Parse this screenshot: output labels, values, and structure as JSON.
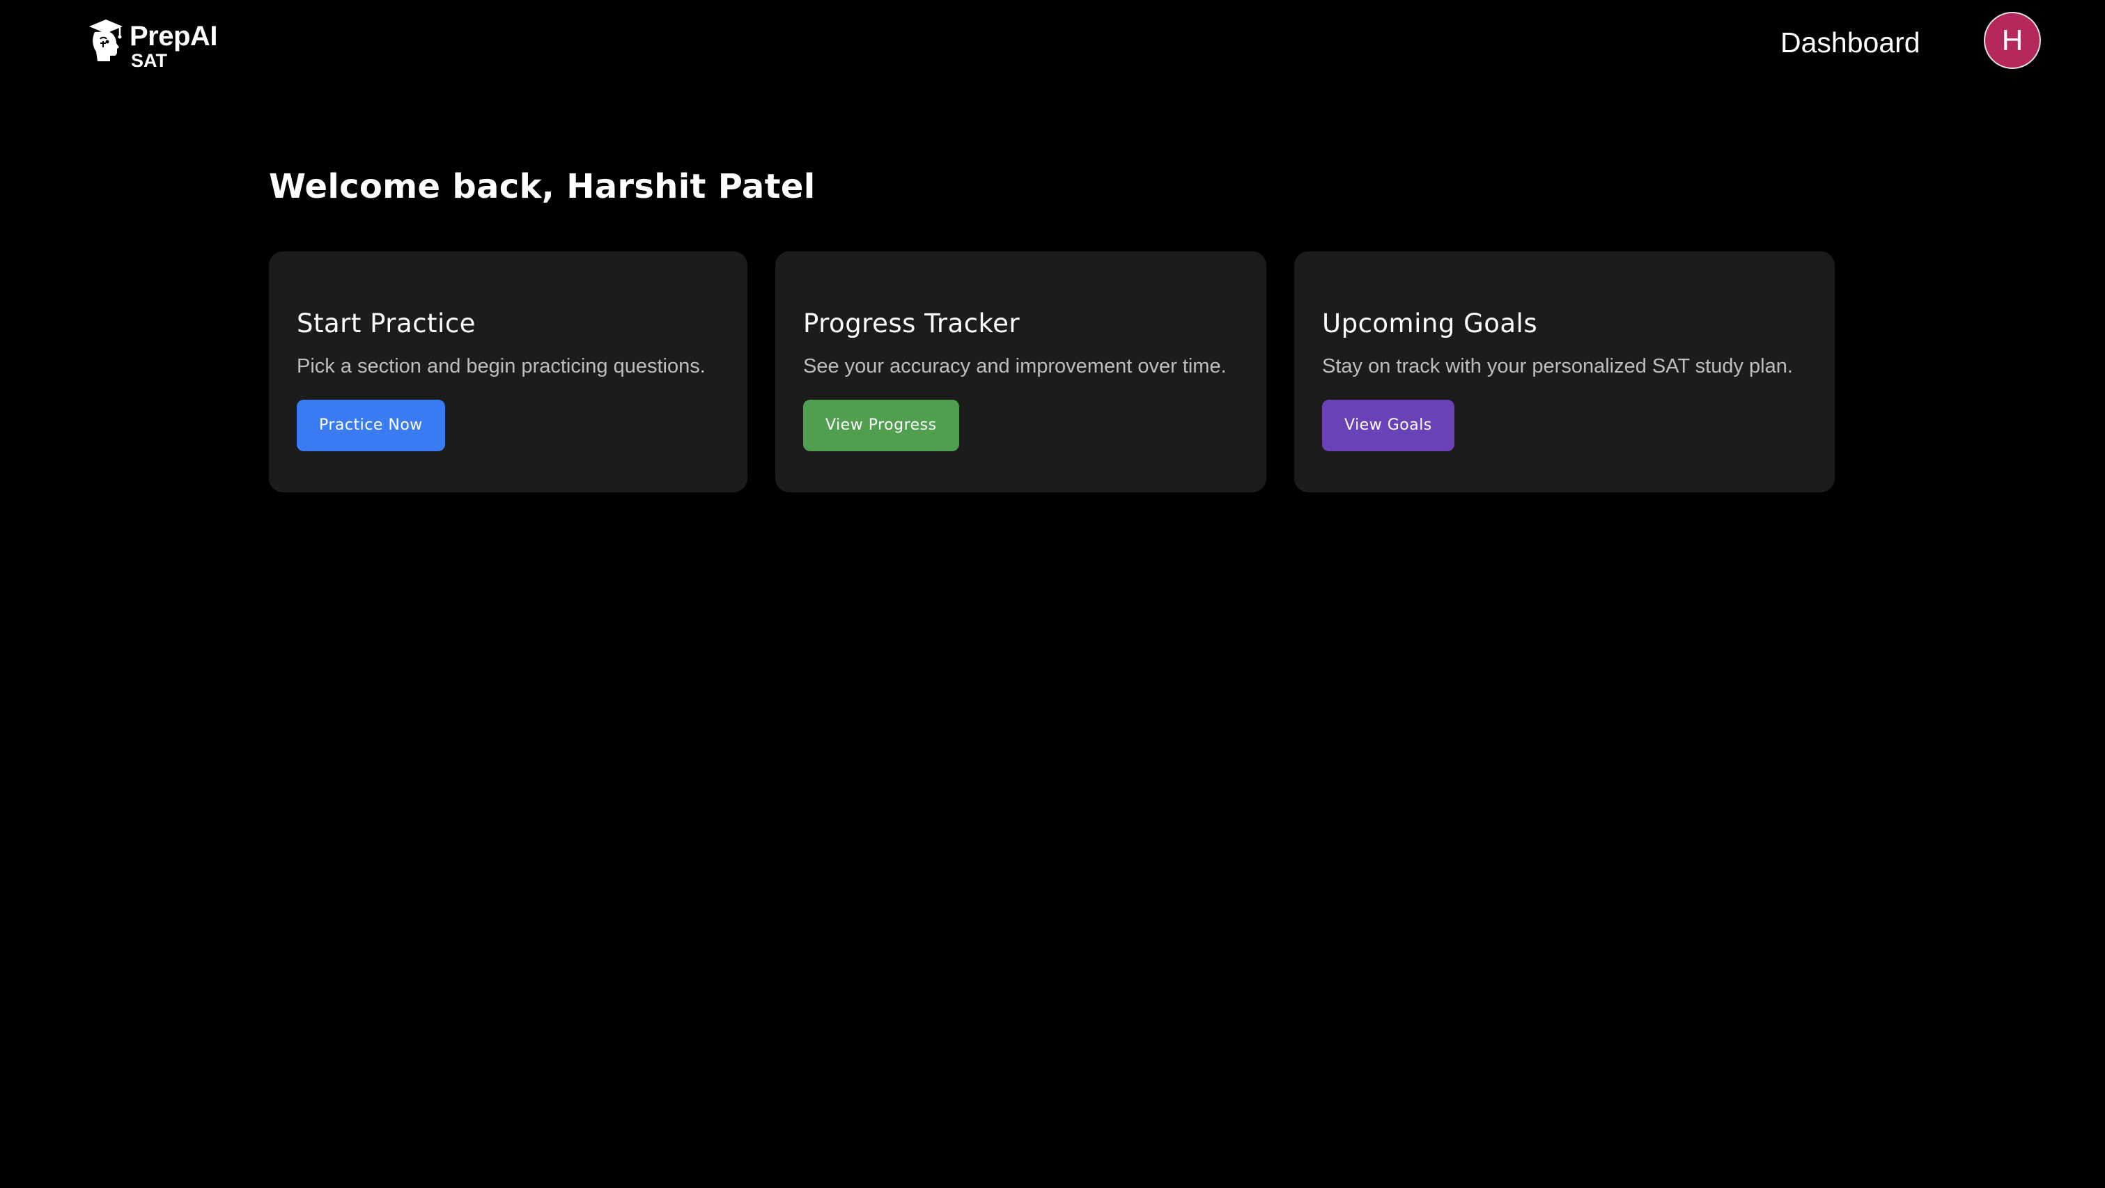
{
  "header": {
    "logo": {
      "name": "PrepAI",
      "sub": "SAT",
      "icon": "graduation-cap-head-icon"
    },
    "nav_dashboard": "Dashboard",
    "avatar_initial": "H",
    "avatar_color": "#b5285e"
  },
  "main": {
    "welcome": "Welcome back, Harshit Patel",
    "cards": [
      {
        "title": "Start Practice",
        "description": "Pick a section and begin practicing questions.",
        "button_label": "Practice Now",
        "button_color": "#3b7bf2"
      },
      {
        "title": "Progress Tracker",
        "description": "See your accuracy and improvement over time.",
        "button_label": "View Progress",
        "button_color": "#4f9f4f"
      },
      {
        "title": "Upcoming Goals",
        "description": "Stay on track with your personalized SAT study plan.",
        "button_label": "View Goals",
        "button_color": "#6a42b8"
      }
    ]
  }
}
